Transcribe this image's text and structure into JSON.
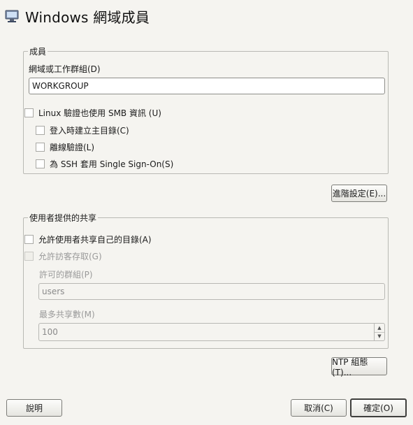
{
  "window": {
    "title": "Windows 網域成員"
  },
  "membership": {
    "legend": "成員",
    "domain_label": "網域或工作群組(D)",
    "domain_value": "WORKGROUP",
    "use_smb_label": "Linux 驗證也使用 SMB 資訊 (U)",
    "create_home_label": "登入時建立主目錄(C)",
    "offline_auth_label": "離線驗證(L)",
    "sso_label": "為 SSH 套用 Single Sign-On(S)"
  },
  "advanced_button": "進階設定(E)...",
  "shares": {
    "legend": "使用者提供的共享",
    "allow_user_shares_label": "允許使用者共享自己的目錄(A)",
    "allow_guest_label": "允許訪客存取(G)",
    "permitted_group_label": "許可的群組(P)",
    "permitted_group_value": "users",
    "max_shares_label": "最多共享數(M)",
    "max_shares_value": "100"
  },
  "ntp_button": "NTP 組態(T)...",
  "footer": {
    "help": "說明",
    "cancel": "取消(C)",
    "ok": "確定(O)"
  }
}
